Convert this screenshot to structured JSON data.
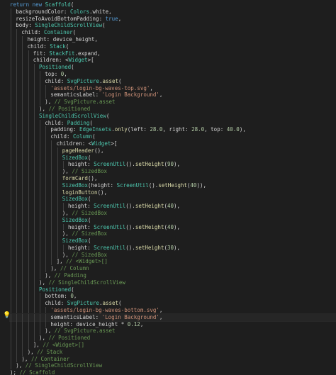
{
  "editor": {
    "lines": [
      {
        "indent": 0,
        "segments": [
          [
            "kw",
            "return "
          ],
          [
            "kw",
            "new "
          ],
          [
            "cls",
            "Scaffold"
          ],
          [
            "punc",
            "("
          ]
        ]
      },
      {
        "indent": 1,
        "segments": [
          [
            "prop",
            "backgroundColor: "
          ],
          [
            "cls",
            "Colors"
          ],
          [
            "punc",
            ".white,"
          ]
        ]
      },
      {
        "indent": 1,
        "segments": [
          [
            "prop",
            "resizeToAvoidBottomPadding: "
          ],
          [
            "kw",
            "true"
          ],
          [
            "punc",
            ","
          ]
        ]
      },
      {
        "indent": 1,
        "segments": [
          [
            "prop",
            "body: "
          ],
          [
            "cls",
            "SingleChildScrollView"
          ],
          [
            "punc",
            "("
          ]
        ]
      },
      {
        "indent": 2,
        "segments": [
          [
            "prop",
            "child: "
          ],
          [
            "cls",
            "Container"
          ],
          [
            "punc",
            "("
          ]
        ]
      },
      {
        "indent": 3,
        "segments": [
          [
            "prop",
            "height: device_height,"
          ]
        ]
      },
      {
        "indent": 3,
        "segments": [
          [
            "prop",
            "child: "
          ],
          [
            "cls",
            "Stack"
          ],
          [
            "punc",
            "("
          ]
        ]
      },
      {
        "indent": 4,
        "segments": [
          [
            "prop",
            "fit: "
          ],
          [
            "cls",
            "StackFit"
          ],
          [
            "punc",
            ".expand,"
          ]
        ]
      },
      {
        "indent": 4,
        "segments": [
          [
            "prop",
            "children: <"
          ],
          [
            "cls",
            "Widget"
          ],
          [
            "punc",
            ">["
          ]
        ]
      },
      {
        "indent": 5,
        "segments": [
          [
            "cls",
            "Positioned"
          ],
          [
            "punc",
            "("
          ]
        ]
      },
      {
        "indent": 6,
        "segments": [
          [
            "prop",
            "top: "
          ],
          [
            "num",
            "0"
          ],
          [
            "punc",
            ","
          ]
        ]
      },
      {
        "indent": 6,
        "segments": [
          [
            "prop",
            "child: "
          ],
          [
            "cls",
            "SvgPicture"
          ],
          [
            "punc",
            "."
          ],
          [
            "fn",
            "asset"
          ],
          [
            "punc",
            "("
          ]
        ]
      },
      {
        "indent": 7,
        "segments": [
          [
            "str",
            "'assets/login-bg-waves-top.svg'"
          ],
          [
            "punc",
            ","
          ]
        ]
      },
      {
        "indent": 7,
        "segments": [
          [
            "prop",
            "semanticsLabel: "
          ],
          [
            "str",
            "'Login Background'"
          ],
          [
            "punc",
            ","
          ]
        ]
      },
      {
        "indent": 6,
        "segments": [
          [
            "punc",
            "), "
          ],
          [
            "com",
            "// SvgPicture.asset"
          ]
        ]
      },
      {
        "indent": 5,
        "segments": [
          [
            "punc",
            "), "
          ],
          [
            "com",
            "// Positioned"
          ]
        ]
      },
      {
        "indent": 5,
        "segments": [
          [
            "cls",
            "SingleChildScrollView"
          ],
          [
            "punc",
            "("
          ]
        ]
      },
      {
        "indent": 6,
        "segments": [
          [
            "prop",
            "child: "
          ],
          [
            "cls",
            "Padding"
          ],
          [
            "punc",
            "("
          ]
        ]
      },
      {
        "indent": 7,
        "segments": [
          [
            "prop",
            "padding: "
          ],
          [
            "cls",
            "EdgeInsets"
          ],
          [
            "punc",
            "."
          ],
          [
            "fn",
            "only"
          ],
          [
            "punc",
            "(left: "
          ],
          [
            "num",
            "28.0"
          ],
          [
            "punc",
            ", right: "
          ],
          [
            "num",
            "28.0"
          ],
          [
            "punc",
            ", top: "
          ],
          [
            "num",
            "40.0"
          ],
          [
            "punc",
            "),"
          ]
        ]
      },
      {
        "indent": 7,
        "segments": [
          [
            "prop",
            "child: "
          ],
          [
            "cls",
            "Column"
          ],
          [
            "punc",
            "("
          ]
        ]
      },
      {
        "indent": 8,
        "segments": [
          [
            "prop",
            "children: <"
          ],
          [
            "cls",
            "Widget"
          ],
          [
            "punc",
            ">["
          ]
        ]
      },
      {
        "indent": 9,
        "segments": [
          [
            "fn",
            "pageHeader"
          ],
          [
            "punc",
            "(),"
          ]
        ]
      },
      {
        "indent": 9,
        "segments": [
          [
            "cls",
            "SizedBox"
          ],
          [
            "punc",
            "("
          ]
        ]
      },
      {
        "indent": 10,
        "segments": [
          [
            "prop",
            "height: "
          ],
          [
            "cls",
            "ScreenUtil"
          ],
          [
            "punc",
            "()."
          ],
          [
            "fn",
            "setHeight"
          ],
          [
            "punc",
            "("
          ],
          [
            "num",
            "90"
          ],
          [
            "punc",
            "),"
          ]
        ]
      },
      {
        "indent": 9,
        "segments": [
          [
            "punc",
            "), "
          ],
          [
            "com",
            "// SizedBox"
          ]
        ]
      },
      {
        "indent": 9,
        "segments": [
          [
            "fn",
            "formCard"
          ],
          [
            "punc",
            "(),"
          ]
        ]
      },
      {
        "indent": 9,
        "segments": [
          [
            "cls",
            "SizedBox"
          ],
          [
            "punc",
            "(height: "
          ],
          [
            "cls",
            "ScreenUtil"
          ],
          [
            "punc",
            "()."
          ],
          [
            "fn",
            "setHeight"
          ],
          [
            "punc",
            "("
          ],
          [
            "num",
            "40"
          ],
          [
            "punc",
            ")),"
          ]
        ]
      },
      {
        "indent": 9,
        "segments": [
          [
            "fn",
            "loginButton"
          ],
          [
            "punc",
            "(),"
          ]
        ]
      },
      {
        "indent": 9,
        "segments": [
          [
            "cls",
            "SizedBox"
          ],
          [
            "punc",
            "("
          ]
        ]
      },
      {
        "indent": 10,
        "segments": [
          [
            "prop",
            "height: "
          ],
          [
            "cls",
            "ScreenUtil"
          ],
          [
            "punc",
            "()."
          ],
          [
            "fn",
            "setHeight"
          ],
          [
            "punc",
            "("
          ],
          [
            "num",
            "40"
          ],
          [
            "punc",
            "),"
          ]
        ]
      },
      {
        "indent": 9,
        "segments": [
          [
            "punc",
            "), "
          ],
          [
            "com",
            "// SizedBox"
          ]
        ]
      },
      {
        "indent": 9,
        "segments": [
          [
            "cls",
            "SizedBox"
          ],
          [
            "punc",
            "("
          ]
        ]
      },
      {
        "indent": 10,
        "segments": [
          [
            "prop",
            "height: "
          ],
          [
            "cls",
            "ScreenUtil"
          ],
          [
            "punc",
            "()."
          ],
          [
            "fn",
            "setHeight"
          ],
          [
            "punc",
            "("
          ],
          [
            "num",
            "40"
          ],
          [
            "punc",
            "),"
          ]
        ]
      },
      {
        "indent": 9,
        "segments": [
          [
            "punc",
            "), "
          ],
          [
            "com",
            "// SizedBox"
          ]
        ]
      },
      {
        "indent": 9,
        "segments": [
          [
            "cls",
            "SizedBox"
          ],
          [
            "punc",
            "("
          ]
        ]
      },
      {
        "indent": 10,
        "segments": [
          [
            "prop",
            "height: "
          ],
          [
            "cls",
            "ScreenUtil"
          ],
          [
            "punc",
            "()."
          ],
          [
            "fn",
            "setHeight"
          ],
          [
            "punc",
            "("
          ],
          [
            "num",
            "30"
          ],
          [
            "punc",
            "),"
          ]
        ]
      },
      {
        "indent": 9,
        "segments": [
          [
            "punc",
            "), "
          ],
          [
            "com",
            "// SizedBox"
          ]
        ]
      },
      {
        "indent": 8,
        "segments": [
          [
            "punc",
            "], "
          ],
          [
            "com",
            "// <Widget>[]"
          ]
        ]
      },
      {
        "indent": 7,
        "segments": [
          [
            "punc",
            "), "
          ],
          [
            "com",
            "// Column"
          ]
        ]
      },
      {
        "indent": 6,
        "segments": [
          [
            "punc",
            "), "
          ],
          [
            "com",
            "// Padding"
          ]
        ]
      },
      {
        "indent": 5,
        "segments": [
          [
            "punc",
            "), "
          ],
          [
            "com",
            "// SingleChildScrollView"
          ]
        ]
      },
      {
        "indent": 5,
        "segments": [
          [
            "cls",
            "Positioned"
          ],
          [
            "punc",
            "("
          ]
        ]
      },
      {
        "indent": 6,
        "segments": [
          [
            "prop",
            "bottom: "
          ],
          [
            "num",
            "0"
          ],
          [
            "punc",
            ","
          ]
        ]
      },
      {
        "indent": 6,
        "segments": [
          [
            "prop",
            "child: "
          ],
          [
            "cls",
            "SvgPicture"
          ],
          [
            "punc",
            "."
          ],
          [
            "fn",
            "asset"
          ],
          [
            "punc",
            "("
          ]
        ]
      },
      {
        "indent": 7,
        "segments": [
          [
            "str",
            "'assets/login-bg-waves-bottom.svg'"
          ],
          [
            "punc",
            ","
          ]
        ]
      },
      {
        "indent": 7,
        "segments": [
          [
            "prop",
            "semanticsLabel: "
          ],
          [
            "str",
            "'Login Background'"
          ],
          [
            "punc",
            ","
          ]
        ]
      },
      {
        "indent": 7,
        "segments": [
          [
            "prop",
            "height: device_height * "
          ],
          [
            "num",
            "0.12"
          ],
          [
            "punc",
            ","
          ]
        ]
      },
      {
        "indent": 6,
        "segments": [
          [
            "punc",
            "), "
          ],
          [
            "com",
            "// SvgPicture.asset"
          ]
        ]
      },
      {
        "indent": 5,
        "segments": [
          [
            "punc",
            "), "
          ],
          [
            "com",
            "// Positioned"
          ]
        ]
      },
      {
        "indent": 4,
        "segments": [
          [
            "punc",
            "], "
          ],
          [
            "com",
            "// <Widget>[]"
          ]
        ]
      },
      {
        "indent": 3,
        "segments": [
          [
            "punc",
            "), "
          ],
          [
            "com",
            "// Stack"
          ]
        ]
      },
      {
        "indent": 2,
        "segments": [
          [
            "punc",
            "), "
          ],
          [
            "com",
            "// Container"
          ]
        ]
      },
      {
        "indent": 1,
        "segments": [
          [
            "punc",
            "), "
          ],
          [
            "com",
            "// SingleChildScrollView"
          ]
        ]
      },
      {
        "indent": 0,
        "segments": [
          [
            "punc",
            "); "
          ],
          [
            "com",
            "// Scaffold"
          ]
        ]
      }
    ],
    "lightbulb_icon": "lightbulb-icon",
    "colors": {
      "background": "#1e1e1e",
      "keyword": "#569cd6",
      "class": "#4ec9b0",
      "string": "#ce9178",
      "number": "#b5cea8",
      "comment": "#6a9955",
      "function": "#dcdcaa"
    }
  }
}
